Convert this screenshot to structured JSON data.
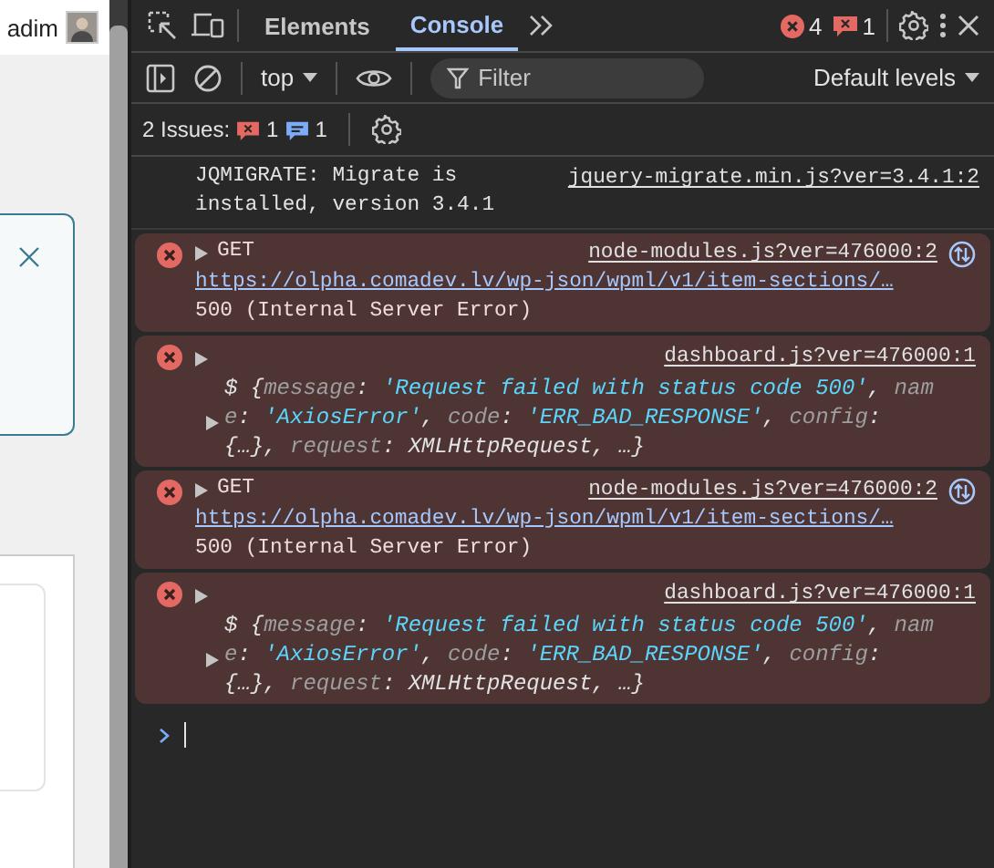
{
  "page": {
    "user_name": "adim"
  },
  "devtools": {
    "tabs": [
      {
        "label": "Elements",
        "selected": false
      },
      {
        "label": "Console",
        "selected": true
      }
    ],
    "error_count": "4",
    "issue_count": "1",
    "context": "top",
    "filter": {
      "placeholder": "Filter"
    },
    "levels": "Default levels",
    "issues": {
      "label": "2 Issues:",
      "errors": "1",
      "infos": "1"
    },
    "messages": [
      {
        "kind": "log",
        "text": "JQMIGRATE: Migrate is installed, version 3.4.1",
        "source": "jquery-migrate.min.js?ver=3.4.1:2"
      },
      {
        "kind": "network",
        "method": "GET",
        "source": "node-modules.js?ver=476000:2",
        "url": "https://olpha.comadev.lv/wp-json/wpml/v1/item-sections/…",
        "status": "500 (Internal Server Error)"
      },
      {
        "kind": "object",
        "source": "dashboard.js?ver=476000:1",
        "segments": [
          {
            "kind": "plain",
            "text": "$"
          },
          {
            "kind": "plain",
            "text": " {"
          },
          {
            "kind": "key",
            "text": "message"
          },
          {
            "kind": "plain",
            "text": ": "
          },
          {
            "kind": "string",
            "text": "'Request failed with status code 500'"
          },
          {
            "kind": "plain",
            "text": ", "
          },
          {
            "kind": "key",
            "text": "name"
          },
          {
            "kind": "plain",
            "text": ": "
          },
          {
            "kind": "string",
            "text": "'AxiosError'"
          },
          {
            "kind": "plain",
            "text": ", "
          },
          {
            "kind": "key",
            "text": "code"
          },
          {
            "kind": "plain",
            "text": ": "
          },
          {
            "kind": "string",
            "text": "'ERR_BAD_RESPONSE'"
          },
          {
            "kind": "plain",
            "text": ", "
          },
          {
            "kind": "key",
            "text": "config"
          },
          {
            "kind": "plain",
            "text": ": "
          },
          {
            "kind": "plain",
            "text": "{…}"
          },
          {
            "kind": "plain",
            "text": ", "
          },
          {
            "kind": "key",
            "text": "request"
          },
          {
            "kind": "plain",
            "text": ": "
          },
          {
            "kind": "plain",
            "text": "XMLHttpRequest"
          },
          {
            "kind": "plain",
            "text": ", "
          },
          {
            "kind": "plain",
            "text": "…"
          },
          {
            "kind": "plain",
            "text": "}"
          }
        ]
      },
      {
        "kind": "network",
        "method": "GET",
        "source": "node-modules.js?ver=476000:2",
        "url": "https://olpha.comadev.lv/wp-json/wpml/v1/item-sections/…",
        "status": "500 (Internal Server Error)"
      },
      {
        "kind": "object",
        "source": "dashboard.js?ver=476000:1",
        "segments": [
          {
            "kind": "plain",
            "text": "$"
          },
          {
            "kind": "plain",
            "text": " {"
          },
          {
            "kind": "key",
            "text": "message"
          },
          {
            "kind": "plain",
            "text": ": "
          },
          {
            "kind": "string",
            "text": "'Request failed with status code 500'"
          },
          {
            "kind": "plain",
            "text": ", "
          },
          {
            "kind": "key",
            "text": "name"
          },
          {
            "kind": "plain",
            "text": ": "
          },
          {
            "kind": "string",
            "text": "'AxiosError'"
          },
          {
            "kind": "plain",
            "text": ", "
          },
          {
            "kind": "key",
            "text": "code"
          },
          {
            "kind": "plain",
            "text": ": "
          },
          {
            "kind": "string",
            "text": "'ERR_BAD_RESPONSE'"
          },
          {
            "kind": "plain",
            "text": ", "
          },
          {
            "kind": "key",
            "text": "config"
          },
          {
            "kind": "plain",
            "text": ": "
          },
          {
            "kind": "plain",
            "text": "{…}"
          },
          {
            "kind": "plain",
            "text": ", "
          },
          {
            "kind": "key",
            "text": "request"
          },
          {
            "kind": "plain",
            "text": ": "
          },
          {
            "kind": "plain",
            "text": "XMLHttpRequest"
          },
          {
            "kind": "plain",
            "text": ", "
          },
          {
            "kind": "plain",
            "text": "…"
          },
          {
            "kind": "plain",
            "text": "}"
          }
        ]
      }
    ]
  }
}
